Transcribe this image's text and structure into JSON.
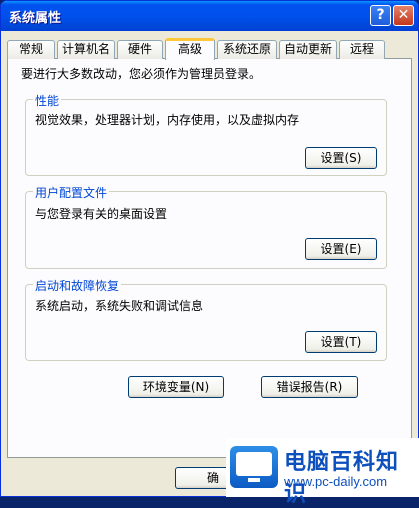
{
  "window": {
    "title": "系统属性",
    "help_glyph": "?",
    "close_glyph": "✕"
  },
  "tabs": [
    "常规",
    "计算机名",
    "硬件",
    "高级",
    "系统还原",
    "自动更新",
    "远程"
  ],
  "active_tab": "高级",
  "admin_note": "要进行大多数改动，您必须作为管理员登录。",
  "groups": [
    {
      "legend": "性能",
      "description": "视觉效果，处理器计划，内存使用，以及虚拟内存",
      "button": "设置(S)"
    },
    {
      "legend": "用户配置文件",
      "description": "与您登录有关的桌面设置",
      "button": "设置(E)"
    },
    {
      "legend": "启动和故障恢复",
      "description": "系统启动，系统失败和调试信息",
      "button": "设置(T)"
    }
  ],
  "bottom_buttons": {
    "env": "环境变量(N)",
    "error": "错误报告(R)"
  },
  "footer": {
    "ok_label": "确"
  },
  "watermark": {
    "title": "电脑百科知识",
    "url": "www.pc-daily.com"
  },
  "colors": {
    "titlebar": "#0053ee",
    "accent_legend": "#0046d5",
    "tab_highlight": "#ffc83c",
    "face": "#ece9d8"
  }
}
